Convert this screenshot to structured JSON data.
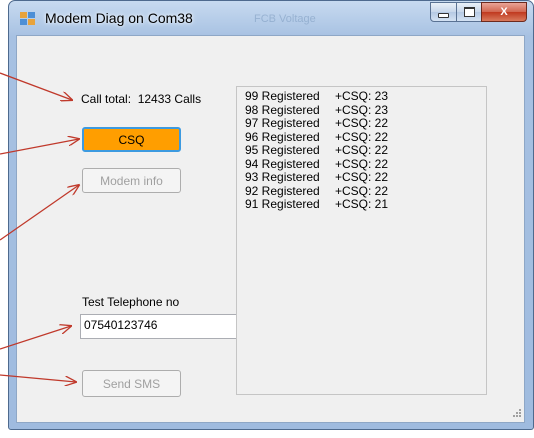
{
  "window": {
    "title": "Modem Diag on Com38",
    "background_title": "FCB Voltage",
    "controls": {
      "minimize": "minimize",
      "maximize": "maximize",
      "close": "X"
    }
  },
  "call_total": {
    "label": "Call total:",
    "value": "12433 Calls"
  },
  "buttons": {
    "csq": "CSQ",
    "modem_info": "Modem info",
    "send_sms": "Send SMS"
  },
  "telephone": {
    "label": "Test Telephone no",
    "value": "07540123746"
  },
  "log": [
    {
      "status": "99 Registered",
      "csq": "+CSQ: 23"
    },
    {
      "status": "98 Registered",
      "csq": "+CSQ: 23"
    },
    {
      "status": "97 Registered",
      "csq": "+CSQ: 22"
    },
    {
      "status": "96 Registered",
      "csq": "+CSQ: 22"
    },
    {
      "status": "95 Registered",
      "csq": "+CSQ: 22"
    },
    {
      "status": "94 Registered",
      "csq": "+CSQ: 22"
    },
    {
      "status": "93 Registered",
      "csq": "+CSQ: 22"
    },
    {
      "status": "92 Registered",
      "csq": "+CSQ: 22"
    },
    {
      "status": "91 Registered",
      "csq": "+CSQ: 21"
    }
  ],
  "colors": {
    "csq_button": "#ff9e00",
    "focus_border": "#3c9ae0",
    "annotation_arrow": "#c0392b"
  },
  "icons": [
    "app-icon",
    "minimize-icon",
    "maximize-icon",
    "close-icon",
    "size-grip-icon",
    "arrow-icon"
  ]
}
